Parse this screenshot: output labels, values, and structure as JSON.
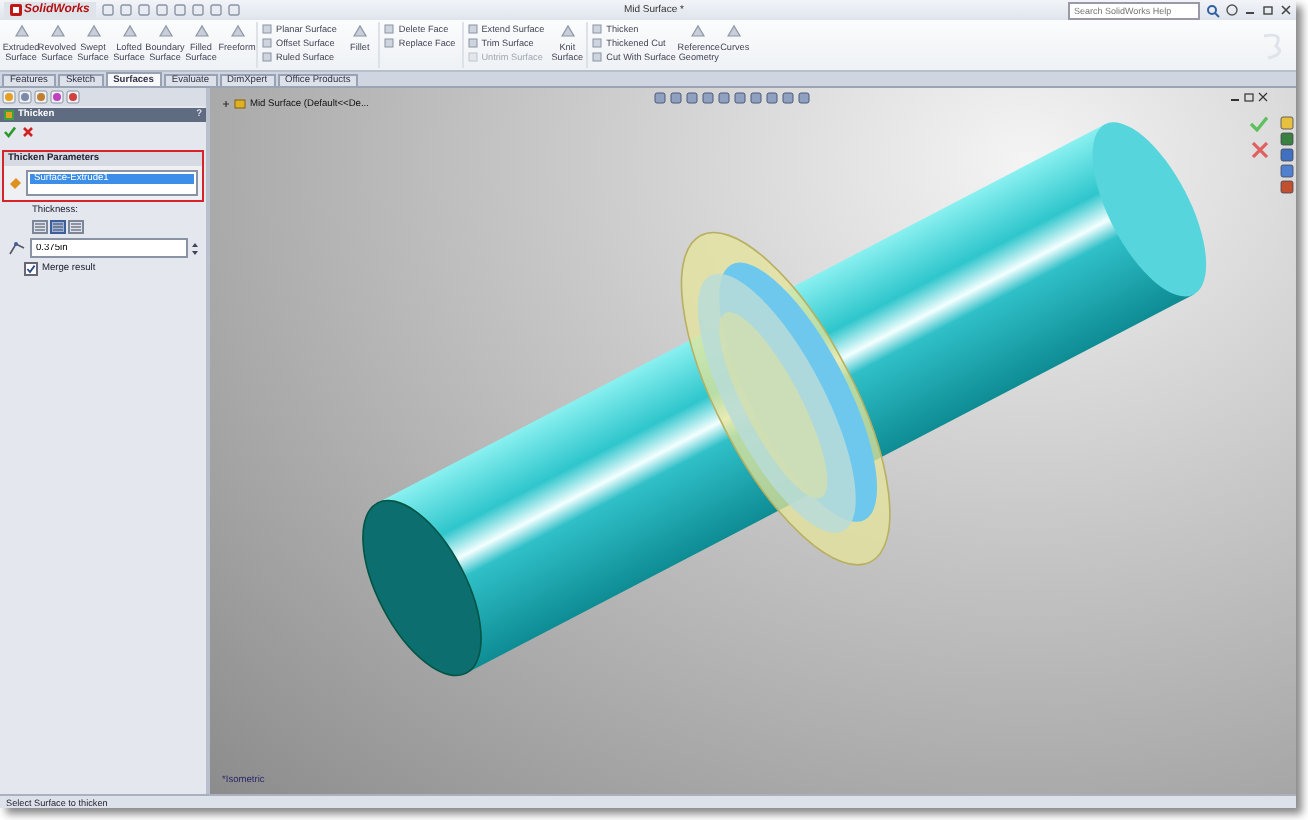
{
  "app": {
    "logo": "SolidWorks",
    "title": "Mid Surface *",
    "search_placeholder": "Search SolidWorks Help"
  },
  "ribbon": [
    {
      "kind": "large",
      "label": "Extruded Surface"
    },
    {
      "kind": "large",
      "label": "Revolved Surface"
    },
    {
      "kind": "large",
      "label": "Swept Surface"
    },
    {
      "kind": "large",
      "label": "Lofted Surface"
    },
    {
      "kind": "large",
      "label": "Boundary Surface"
    },
    {
      "kind": "large",
      "label": "Filled Surface"
    },
    {
      "kind": "large",
      "label": "Freeform"
    },
    {
      "kind": "stack",
      "items": [
        {
          "label": "Planar Surface",
          "disabled": false
        },
        {
          "label": "Offset Surface",
          "disabled": false
        },
        {
          "label": "Ruled Surface",
          "disabled": false
        }
      ]
    },
    {
      "kind": "large",
      "label": "Fillet"
    },
    {
      "kind": "stack",
      "items": [
        {
          "label": "Delete Face",
          "disabled": false
        },
        {
          "label": "Replace Face",
          "disabled": false
        }
      ]
    },
    {
      "kind": "stack",
      "items": [
        {
          "label": "Extend Surface",
          "disabled": false
        },
        {
          "label": "Trim Surface",
          "disabled": false
        },
        {
          "label": "Untrim Surface",
          "disabled": true
        }
      ]
    },
    {
      "kind": "large",
      "label": "Knit Surface"
    },
    {
      "kind": "stack",
      "items": [
        {
          "label": "Thicken",
          "disabled": false
        },
        {
          "label": "Thickened Cut",
          "disabled": false
        },
        {
          "label": "Cut With Surface",
          "disabled": false
        }
      ]
    },
    {
      "kind": "large",
      "label": "Reference Geometry"
    },
    {
      "kind": "large",
      "label": "Curves"
    }
  ],
  "tabs": [
    {
      "label": "Features",
      "selected": false
    },
    {
      "label": "Sketch",
      "selected": false
    },
    {
      "label": "Surfaces",
      "selected": true
    },
    {
      "label": "Evaluate",
      "selected": false
    },
    {
      "label": "DimXpert",
      "selected": false
    },
    {
      "label": "Office Products",
      "selected": false
    }
  ],
  "panel": {
    "title": "Thicken",
    "help": "?",
    "section": "Thicken Parameters",
    "selection": "Surface-Extrude1",
    "thickness_label": "Thickness:",
    "sides": [
      {
        "selected": false
      },
      {
        "selected": true
      },
      {
        "selected": false
      }
    ],
    "thickness": "0.375in",
    "merge": {
      "label": "Merge result",
      "checked": true
    }
  },
  "tree": {
    "label": "Mid Surface  (Default<<De..."
  },
  "view_label": "*Isometric",
  "status": "Select Surface to thicken"
}
